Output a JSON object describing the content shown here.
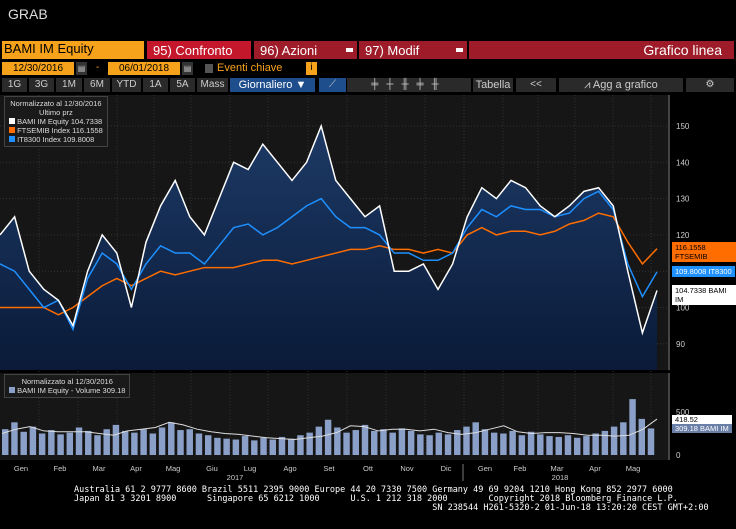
{
  "window_title": "GRAB",
  "header": {
    "security": "BAMI IM Equity",
    "compare": "95) Confronto",
    "actions": "96) Azioni",
    "modify": "97) Modif",
    "chart_type": "Grafico linea"
  },
  "dates": {
    "start": "12/30/2016",
    "sep": "-",
    "end": "06/01/2018",
    "key_events": "Eventi chiave",
    "info": "i"
  },
  "toolbar": {
    "periods": [
      "1G",
      "3G",
      "1M",
      "6M",
      "YTD",
      "1A",
      "5A",
      "Mass"
    ],
    "frequency": "Giornaliero ▼",
    "table": "Tabella",
    "collapse": "<<",
    "add": "Agg a grafico"
  },
  "legend": {
    "title": "Normalizzato al 12/30/2016",
    "subtitle": "Ultimo prz",
    "items": [
      {
        "name": "BAMI IM Equity",
        "value": "104.7338",
        "color": "#ffffff"
      },
      {
        "name": "FTSEMIB Index",
        "value": "116.1558",
        "color": "#ff6d00"
      },
      {
        "name": "IT8300 Index",
        "value": "109.8008",
        "color": "#1e90ff"
      }
    ]
  },
  "tags": {
    "ftse": "116.1558 FTSEMIB",
    "it8300": "109.8008 IT8300",
    "bami": "104.7338 BAMI IM"
  },
  "vol_legend": {
    "title": "Normalizzato al 12/30/2016",
    "item": "BAMI IM Equity - Volume 309.18"
  },
  "vol_tags": {
    "ma": "418.52",
    "vol": "309.18 BAMI IM"
  },
  "chart_data": {
    "type": "line",
    "ylim": [
      85,
      157
    ],
    "yticks": [
      "150",
      "140",
      "130",
      "120",
      "100",
      "90"
    ],
    "xlabels": [
      "Gen",
      "Feb",
      "Mar",
      "Apr",
      "Mag",
      "Giu",
      "Lug",
      "Ago",
      "Set",
      "Ott",
      "Nov",
      "Dic",
      "Gen",
      "Feb",
      "Mar",
      "Apr",
      "Mag"
    ],
    "years": [
      "2017",
      "2018"
    ],
    "series": [
      {
        "name": "BAMI IM Equity",
        "color": "#ffffff",
        "values": [
          120,
          125,
          110,
          105,
          102,
          95,
          110,
          120,
          115,
          100,
          118,
          128,
          135,
          125,
          120,
          130,
          140,
          138,
          145,
          140,
          135,
          140,
          150,
          135,
          130,
          125,
          128,
          110,
          110,
          112,
          105,
          112,
          125,
          133,
          130,
          135,
          133,
          128,
          125,
          128,
          132,
          133,
          128,
          110,
          93,
          104.7
        ]
      },
      {
        "name": "IT8300 Index",
        "color": "#1e90ff",
        "values": [
          112,
          110,
          105,
          100,
          102,
          94,
          108,
          115,
          112,
          105,
          112,
          117,
          115,
          115,
          112,
          117,
          122,
          123,
          120,
          122,
          125,
          128,
          130,
          125,
          122,
          122,
          120,
          115,
          115,
          113,
          113,
          115,
          122,
          127,
          125,
          128,
          127,
          127,
          125,
          126,
          130,
          132,
          127,
          112,
          103,
          109.8
        ]
      },
      {
        "name": "FTSEMIB Index",
        "color": "#ff6d00",
        "values": [
          100,
          100,
          100,
          100,
          98,
          100,
          103,
          106,
          108,
          106,
          108,
          110,
          109,
          110,
          111,
          111,
          111,
          112,
          113,
          113,
          112,
          113,
          114,
          115,
          116,
          116,
          117,
          116,
          116,
          115,
          116,
          115,
          120,
          122,
          120,
          121,
          121,
          120,
          121,
          123,
          124,
          126,
          125,
          118,
          112,
          116.2
        ]
      }
    ],
    "volume": {
      "ylim": [
        0,
        700
      ],
      "yticks": [
        "500",
        "0"
      ],
      "values": [
        300,
        380,
        270,
        330,
        250,
        290,
        240,
        260,
        320,
        280,
        230,
        300,
        350,
        280,
        260,
        300,
        250,
        320,
        380,
        290,
        300,
        250,
        230,
        200,
        190,
        180,
        220,
        170,
        200,
        180,
        210,
        190,
        230,
        260,
        330,
        410,
        320,
        260,
        290,
        350,
        280,
        300,
        260,
        310,
        280,
        240,
        230,
        260,
        240,
        290,
        330,
        380,
        300,
        260,
        250,
        280,
        230,
        270,
        240,
        220,
        210,
        230,
        200,
        220,
        250,
        280,
        330,
        380,
        650,
        420,
        309
      ],
      "ma": [
        250,
        300,
        330,
        280,
        270,
        270,
        270,
        250,
        230,
        280,
        300,
        320,
        380,
        350,
        300,
        270,
        250,
        240,
        220,
        200,
        190,
        180,
        200,
        220,
        260,
        340,
        330,
        280,
        300,
        300,
        280,
        300,
        260,
        240,
        260,
        300,
        340,
        270,
        250,
        260,
        260,
        250,
        230,
        230,
        220,
        230,
        300,
        418
      ]
    }
  }
}
